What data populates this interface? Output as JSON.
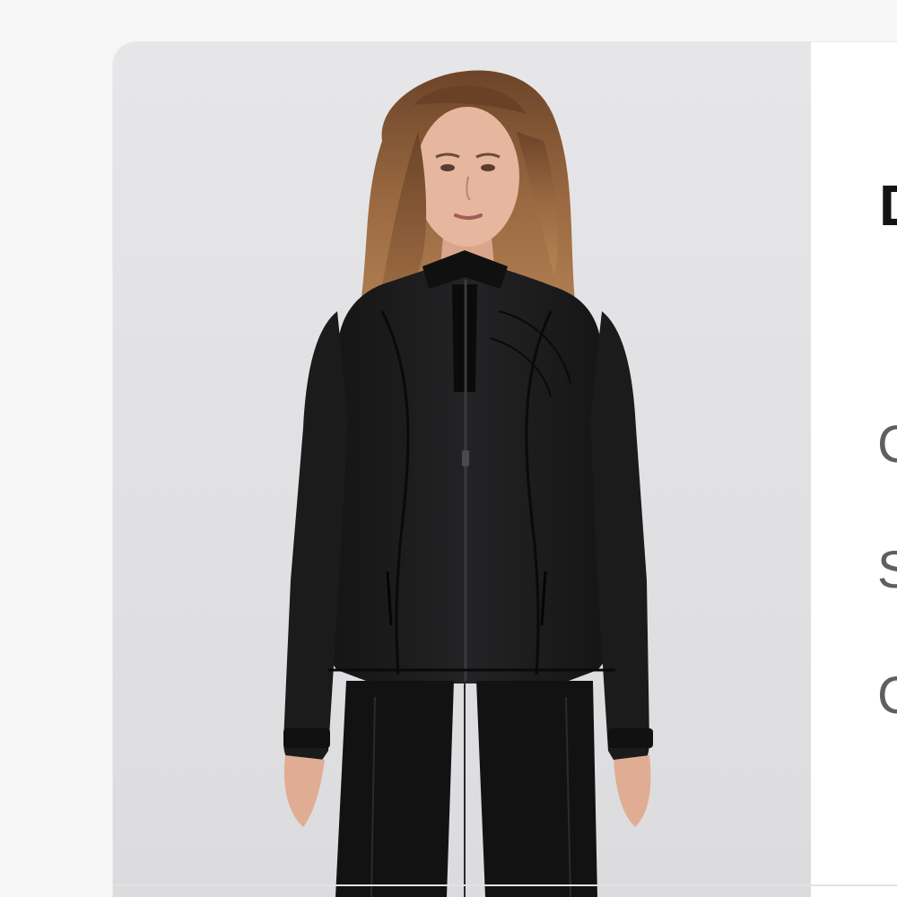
{
  "product": {
    "image_label": "product-photo",
    "title_fragment": "D",
    "detail_fragments": [
      "C",
      "S",
      "C"
    ]
  },
  "colors": {
    "page_background": "#f6f6f6",
    "photo_background": "#e3e3e5",
    "jacket": "#1a1a1b",
    "hair": "#8a5a36",
    "skin": "#e6b79e"
  }
}
